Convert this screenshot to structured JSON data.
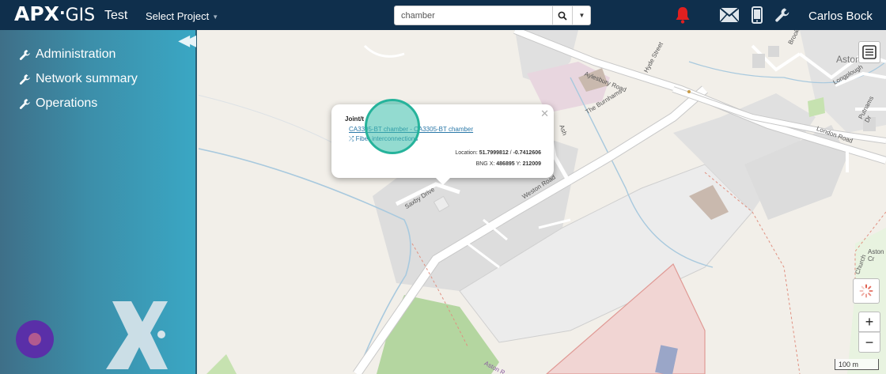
{
  "header": {
    "logo_text_bold": "APX",
    "logo_text_rest": "GIS",
    "project": "Test",
    "select_project_label": "Select Project",
    "user": "Carlos Bock"
  },
  "search": {
    "value": "chamber"
  },
  "sidebar": {
    "items": [
      {
        "label": "Administration"
      },
      {
        "label": "Network summary"
      },
      {
        "label": "Operations"
      }
    ]
  },
  "popup": {
    "title": "Joint/t",
    "link": "CA3305-BT chamber - CA3305-BT chamber",
    "fiber": "Fiber interconnections",
    "location_label": "Location:",
    "lat": "51.7999812",
    "lon": "-0.7412606",
    "bng_x_label": "BNG X:",
    "bng_x": "486895",
    "bng_y_label": "Y:",
    "bng_y": "212009"
  },
  "map": {
    "zoom_in": "+",
    "zoom_out": "−",
    "scale": "100 m",
    "labels": {
      "aylesbury_road": "Aylesbury Road",
      "hyde_street": "Hyde Street",
      "the_burnhams": "The Burnhams",
      "london_road": "London Road",
      "weston_road": "Weston Road",
      "saxby_drive": "Saxby Drive",
      "longplough": "Longplough",
      "putnams_dr": "Putnams Dr",
      "aston": "Aston",
      "brook": "Brook",
      "church": "Church",
      "aston_cr": "Aston Cr",
      "ash": "Ash",
      "rd_bottom": "Aston R"
    }
  },
  "colors": {
    "header_bg": "#0f2f4c",
    "sidebar_accent": "#3aa7c4",
    "alert": "#e02020",
    "highlight": "#26b39b"
  }
}
